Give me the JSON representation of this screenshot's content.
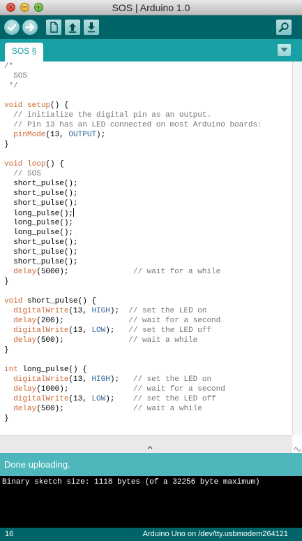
{
  "window": {
    "title": "SOS | Arduino 1.0",
    "controls": {
      "close": "×",
      "minimize": "−",
      "zoom": "+"
    }
  },
  "toolbar": {
    "icons": [
      "verify-check-icon",
      "upload-arrow-icon",
      "new-file-icon",
      "open-arrow-up-icon",
      "save-arrow-down-icon",
      "serial-monitor-magnifier-icon"
    ]
  },
  "tabs": [
    {
      "label": "SOS §"
    }
  ],
  "editor": {
    "lines": [
      "/*",
      "  SOS",
      " */",
      "",
      "void setup() {",
      "  // initialize the digital pin as an output.",
      "  // Pin 13 has an LED connected on most Arduino boards:",
      "  pinMode(13, OUTPUT);",
      "}",
      "",
      "void loop() {",
      "  // SOS",
      "  short_pulse();",
      "  short_pulse();",
      "  short_pulse();",
      "  long_pulse();",
      "  long_pulse();",
      "  long_pulse();",
      "  short_pulse();",
      "  short_pulse();",
      "  short_pulse();",
      "  delay(5000);              // wait for a while",
      "}",
      "",
      "void short_pulse() {",
      "  digitalWrite(13, HIGH);  // set the LED on",
      "  delay(200);              // wait for a second",
      "  digitalWrite(13, LOW);   // set the LED off",
      "  delay(500);              // wait a while",
      "}",
      "",
      "int long_pulse() {",
      "  digitalWrite(13, HIGH);   // set the LED on",
      "  delay(1000);              // wait for a second",
      "  digitalWrite(13, LOW);    // set the LED off",
      "  delay(500);               // wait a while",
      "}"
    ],
    "caret_line": 16
  },
  "status": {
    "message": "Done uploading."
  },
  "console": {
    "text": "Binary sketch size: 1118 bytes (of a 32256 byte maximum)"
  },
  "footer": {
    "line_number": "16",
    "board": "Arduino Uno on /dev/tty.usbmodem264121"
  },
  "colors": {
    "toolbar": "#006468",
    "tabbar": "#17a1a5",
    "status": "#4db7bb",
    "keyword": "#cc6633",
    "constant": "#336699",
    "comment": "#777777"
  }
}
